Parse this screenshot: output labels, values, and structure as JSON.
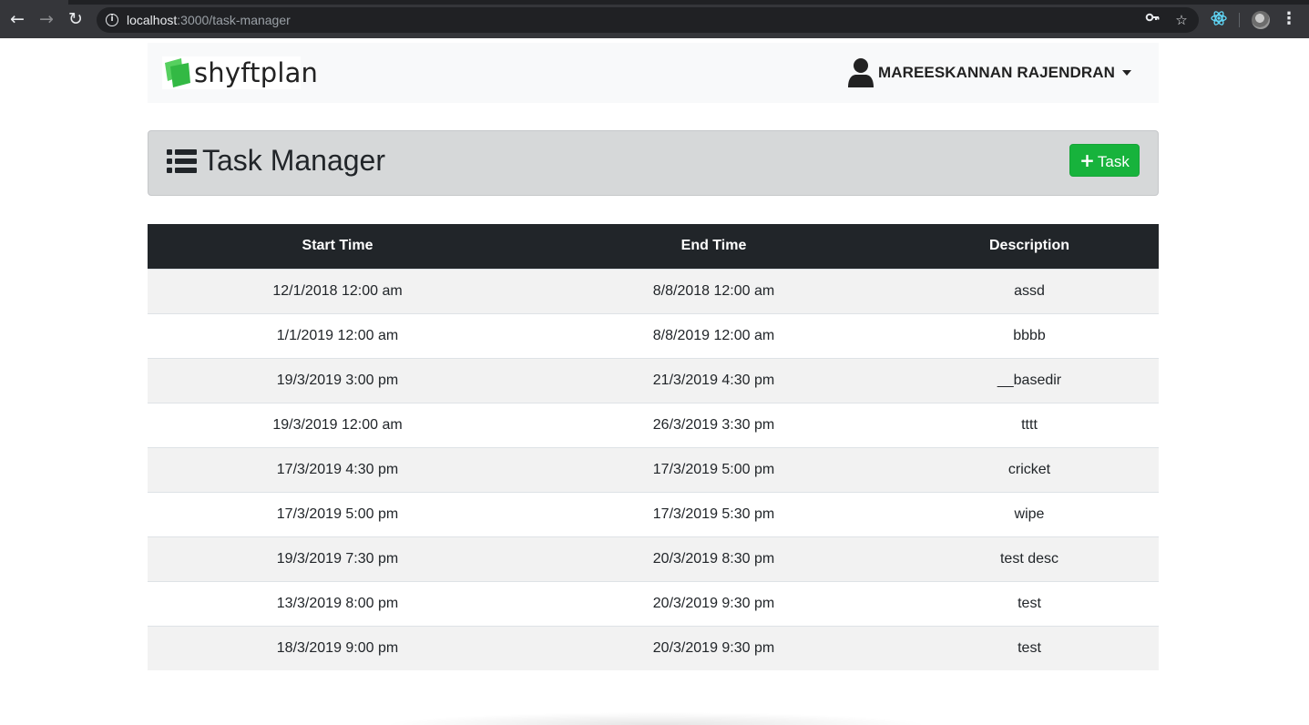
{
  "browser": {
    "url_host": "localhost",
    "url_path": ":3000/task-manager",
    "back_icon": "arrow-left-icon",
    "forward_icon": "arrow-right-icon",
    "reload_icon": "reload-icon",
    "info_icon": "info-icon",
    "key_icon": "key-icon",
    "star_icon": "star-icon",
    "extension_icon": "react-devtools-icon",
    "profile_icon": "profile-avatar-icon",
    "menu_icon": "kebab-menu-icon"
  },
  "navbar": {
    "brand_text": "shyftplan",
    "brand_color": "#3cc34a",
    "user_name": "MAREESKANNAN RAJENDRAN"
  },
  "header": {
    "title": "Task Manager",
    "add_button_label": "Task",
    "add_button_color": "#17b33c"
  },
  "table": {
    "columns": [
      "Start Time",
      "End Time",
      "Description"
    ],
    "rows": [
      [
        "12/1/2018 12:00 am",
        "8/8/2018 12:00 am",
        "assd"
      ],
      [
        "1/1/2019 12:00 am",
        "8/8/2019 12:00 am",
        "bbbb"
      ],
      [
        "19/3/2019 3:00 pm",
        "21/3/2019 4:30 pm",
        "__basedir"
      ],
      [
        "19/3/2019 12:00 am",
        "26/3/2019 3:30 pm",
        "tttt"
      ],
      [
        "17/3/2019 4:30 pm",
        "17/3/2019 5:00 pm",
        "cricket"
      ],
      [
        "17/3/2019 5:00 pm",
        "17/3/2019 5:30 pm",
        "wipe"
      ],
      [
        "19/3/2019 7:30 pm",
        "20/3/2019 8:30 pm",
        "test desc"
      ],
      [
        "13/3/2019 8:00 pm",
        "20/3/2019 9:30 pm",
        "test"
      ],
      [
        "18/3/2019 9:00 pm",
        "20/3/2019 9:30 pm",
        "test"
      ]
    ]
  }
}
